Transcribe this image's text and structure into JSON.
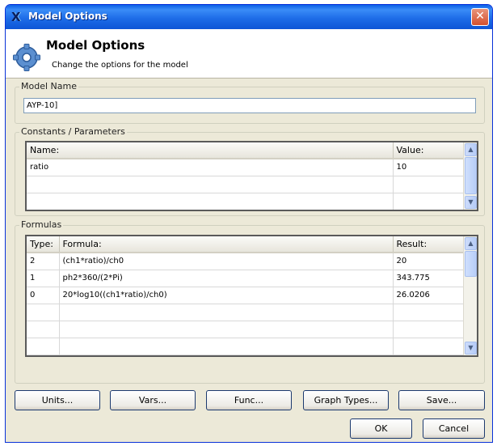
{
  "window": {
    "title": "Model Options",
    "close_glyph": "✕"
  },
  "header": {
    "title": "Model Options",
    "subtitle": "Change the options for the model",
    "icon": "gear-icon"
  },
  "model_name": {
    "label": "Model Name",
    "value": "AYP-10]"
  },
  "constants": {
    "label": "Constants / Parameters",
    "columns": [
      "Name:",
      "Value:"
    ],
    "rows": [
      [
        "ratio",
        "10"
      ],
      [
        "",
        ""
      ],
      [
        "",
        ""
      ]
    ]
  },
  "formulas": {
    "label": "Formulas",
    "columns": [
      "Type:",
      "Formula:",
      "Result:"
    ],
    "rows": [
      [
        "2",
        "(ch1*ratio)/ch0",
        "20"
      ],
      [
        "1",
        "ph2*360/(2*Pi)",
        "343.775"
      ],
      [
        "0",
        "20*log10((ch1*ratio)/ch0)",
        "26.0206"
      ],
      [
        "",
        "",
        ""
      ],
      [
        "",
        "",
        ""
      ],
      [
        "",
        "",
        ""
      ]
    ]
  },
  "buttons": {
    "units": "Units...",
    "vars": "Vars...",
    "func": "Func...",
    "graph_types": "Graph Types...",
    "save": "Save...",
    "ok": "OK",
    "cancel": "Cancel"
  }
}
